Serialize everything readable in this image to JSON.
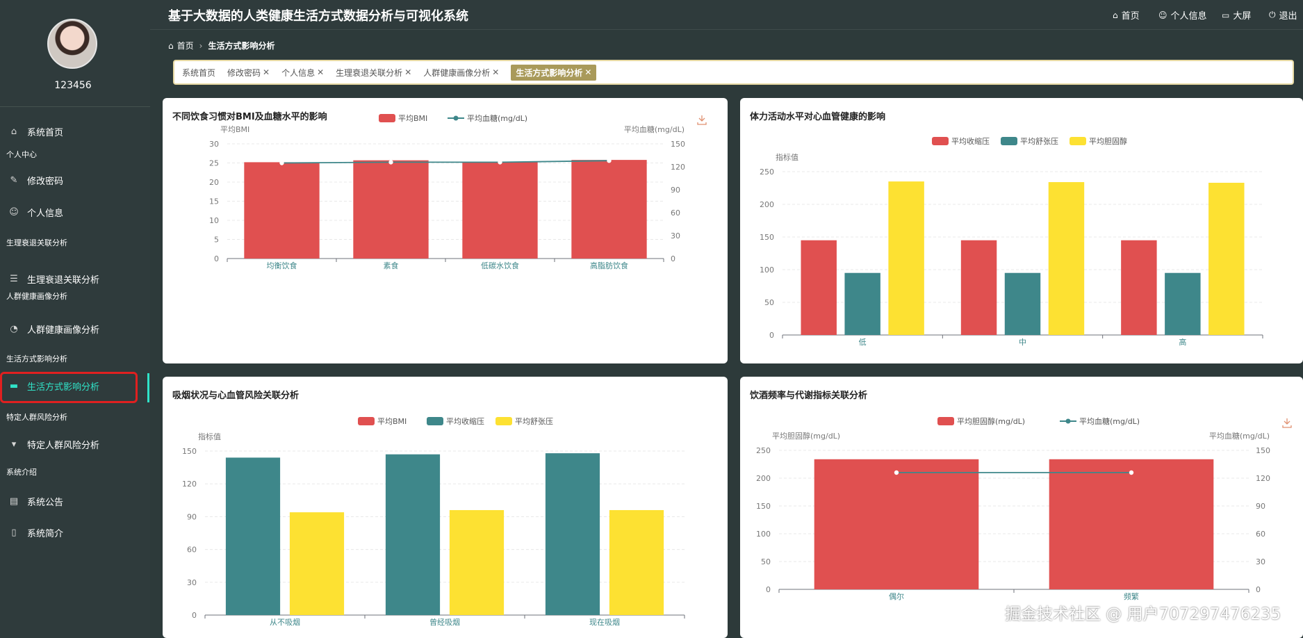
{
  "app": {
    "title": "基于大数据的人类健康生活方式数据分析与可视化系统",
    "nav": [
      {
        "label": "首页",
        "icon": "home-icon"
      },
      {
        "label": "个人信息",
        "icon": "user-icon"
      },
      {
        "label": "大屏",
        "icon": "monitor-icon"
      },
      {
        "label": "退出",
        "icon": "power-icon"
      }
    ]
  },
  "sidebar": {
    "username": "123456",
    "items": [
      {
        "type": "item",
        "label": "系统首页",
        "icon": "home-icon"
      },
      {
        "type": "group",
        "label": "个人中心"
      },
      {
        "type": "item",
        "label": "修改密码",
        "icon": "edit-icon"
      },
      {
        "type": "item",
        "label": "个人信息",
        "icon": "user-icon"
      },
      {
        "type": "group",
        "label": "生理衰退关联分析"
      },
      {
        "type": "item",
        "label": "生理衰退关联分析",
        "icon": "sliders-icon"
      },
      {
        "type": "group",
        "label": "人群健康画像分析"
      },
      {
        "type": "item",
        "label": "人群健康画像分析",
        "icon": "dashboard-icon"
      },
      {
        "type": "group",
        "label": "生活方式影响分析"
      },
      {
        "type": "item",
        "label": "生活方式影响分析",
        "icon": "monitor-icon",
        "active": true
      },
      {
        "type": "group",
        "label": "特定人群风险分析"
      },
      {
        "type": "item",
        "label": "特定人群风险分析",
        "icon": "pin-icon"
      },
      {
        "type": "group",
        "label": "系统介绍"
      },
      {
        "type": "item",
        "label": "系统公告",
        "icon": "notice-icon"
      },
      {
        "type": "item",
        "label": "系统简介",
        "icon": "book-icon"
      }
    ]
  },
  "breadcrumb": {
    "home": "首页",
    "current": "生活方式影响分析"
  },
  "tabs": [
    {
      "label": "系统首页",
      "closable": false
    },
    {
      "label": "修改密码",
      "closable": true
    },
    {
      "label": "个人信息",
      "closable": true
    },
    {
      "label": "生理衰退关联分析",
      "closable": true
    },
    {
      "label": "人群健康画像分析",
      "closable": true
    },
    {
      "label": "生活方式影响分析",
      "closable": true,
      "active": true
    }
  ],
  "colors": {
    "red": "#e05050",
    "teal": "#3e878a",
    "yellow": "#fde132",
    "accent": "#30e3c8"
  },
  "watermark": "掘金技术社区 @ 用户707297476235",
  "chart_data": [
    {
      "title": "不同饮食习惯对BMI及血糖水平的影响",
      "type": "bar",
      "categories": [
        "均衡饮食",
        "素食",
        "低碳水饮食",
        "高脂肪饮食"
      ],
      "series": [
        {
          "name": "平均BMI",
          "type": "bar",
          "axis": "left",
          "color": "#e05050",
          "values": [
            25.2,
            25.7,
            25.3,
            25.8
          ]
        },
        {
          "name": "平均血糖(mg/dL)",
          "type": "line",
          "axis": "right",
          "color": "#3e878a",
          "values": [
            125,
            126,
            126,
            128
          ]
        }
      ],
      "ylabel_left": "平均BMI",
      "ylabel_right": "平均血糖(mg/dL)",
      "ylim_left": [
        0,
        30
      ],
      "yticks_left": [
        "0",
        "5",
        "10",
        "15",
        "20",
        "25",
        "30"
      ],
      "ylim_right": [
        0,
        150
      ],
      "yticks_right": [
        "0",
        "30",
        "60",
        "90",
        "120",
        "150"
      ],
      "download": true
    },
    {
      "title": "体力活动水平对心血管健康的影响",
      "type": "bar",
      "categories": [
        "低",
        "中",
        "高"
      ],
      "series": [
        {
          "name": "平均收缩压",
          "type": "bar",
          "axis": "left",
          "color": "#e05050",
          "values": [
            145,
            145,
            145
          ]
        },
        {
          "name": "平均舒张压",
          "type": "bar",
          "axis": "left",
          "color": "#3e878a",
          "values": [
            95,
            95,
            95
          ]
        },
        {
          "name": "平均胆固醇",
          "type": "bar",
          "axis": "left",
          "color": "#fde132",
          "values": [
            235,
            234,
            233
          ]
        }
      ],
      "ylabel_left": "指标值",
      "ylim_left": [
        0,
        250
      ],
      "yticks_left": [
        "0",
        "50",
        "100",
        "150",
        "200",
        "250"
      ],
      "download": false
    },
    {
      "title": "吸烟状况与心血管风险关联分析",
      "type": "bar",
      "categories": [
        "从不吸烟",
        "曾经吸烟",
        "现在吸烟"
      ],
      "series": [
        {
          "name": "平均BMI",
          "type": "bar",
          "axis": "left",
          "color": "#e05050",
          "values": [
            0,
            0,
            0
          ]
        },
        {
          "name": "平均收缩压",
          "type": "bar",
          "axis": "left",
          "color": "#3e878a",
          "values": [
            144,
            147,
            148
          ]
        },
        {
          "name": "平均舒张压",
          "type": "bar",
          "axis": "left",
          "color": "#fde132",
          "values": [
            94,
            96,
            96
          ]
        }
      ],
      "ylabel_left": "指标值",
      "ylim_left": [
        0,
        150
      ],
      "yticks_left": [
        "0",
        "30",
        "60",
        "90",
        "120",
        "150"
      ],
      "download": false
    },
    {
      "title": "饮酒频率与代谢指标关联分析",
      "type": "bar",
      "categories": [
        "偶尔",
        "频繁"
      ],
      "series": [
        {
          "name": "平均胆固醇(mg/dL)",
          "type": "bar",
          "axis": "left",
          "color": "#e05050",
          "values": [
            234,
            234
          ]
        },
        {
          "name": "平均血糖(mg/dL)",
          "type": "line",
          "axis": "right",
          "color": "#3e878a",
          "values": [
            126,
            126
          ]
        }
      ],
      "ylabel_left": "平均胆固醇(mg/dL)",
      "ylabel_right": "平均血糖(mg/dL)",
      "ylim_left": [
        0,
        250
      ],
      "yticks_left": [
        "0",
        "50",
        "100",
        "150",
        "200",
        "250"
      ],
      "ylim_right": [
        0,
        150
      ],
      "yticks_right": [
        "0",
        "30",
        "60",
        "90",
        "120",
        "150"
      ],
      "download": true
    }
  ]
}
